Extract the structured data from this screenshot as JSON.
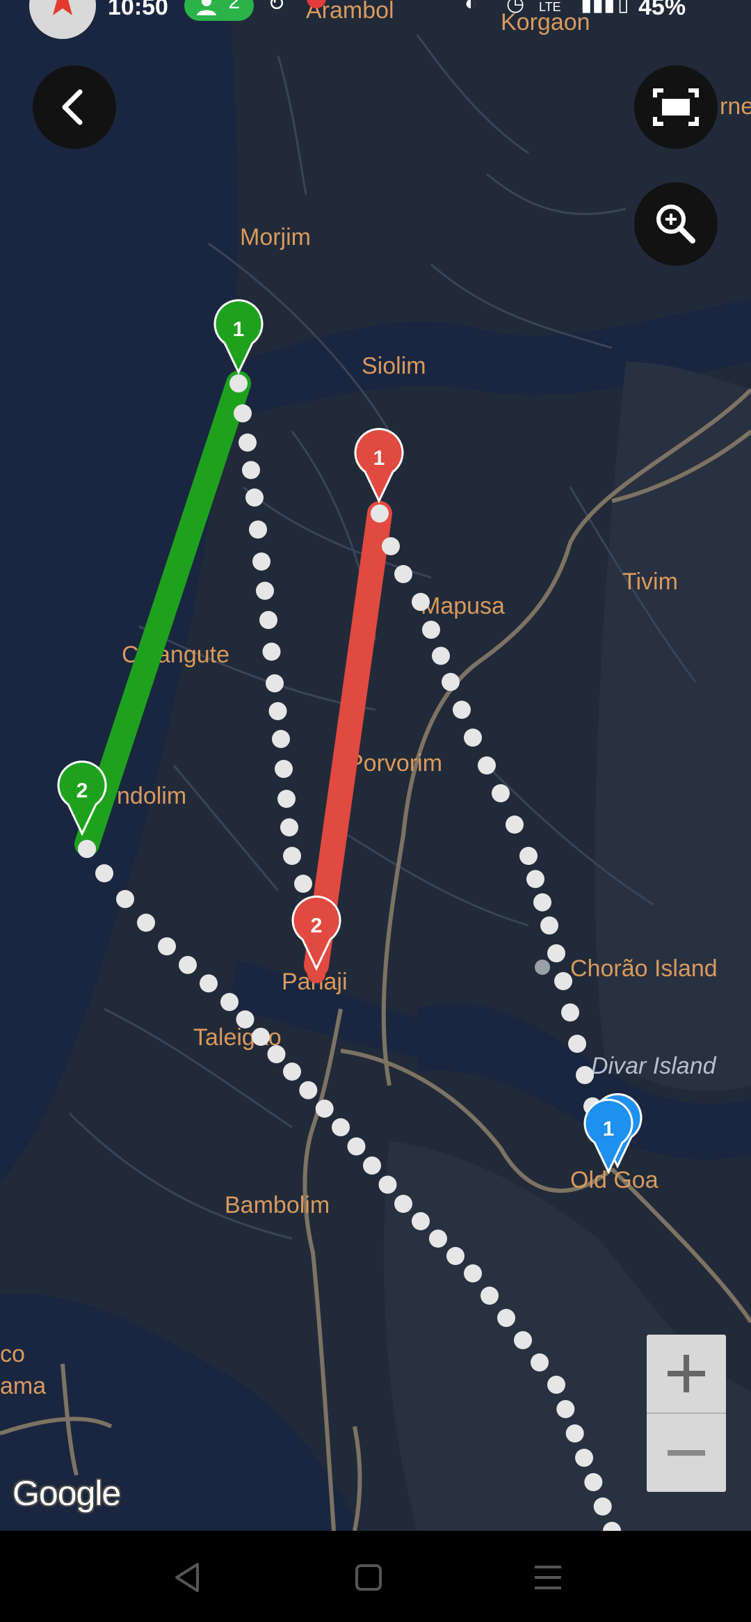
{
  "status_bar": {
    "time": "10:50",
    "notification_count": "2",
    "battery": "45%",
    "icons": [
      "sync-icon",
      "app-notification-icon",
      "vpn-icon",
      "alarm-icon",
      "lte-icon",
      "signal-icon",
      "battery-icon"
    ]
  },
  "map": {
    "provider_logo": "Google",
    "places": {
      "arambol": "Arambol",
      "korgaon": "Korgaon",
      "morjim": "Morjim",
      "siolim": "Siolim",
      "tivim": "Tivim",
      "mapusa": "Mapusa",
      "calangute": "Calangute",
      "candolim": "ndolim",
      "porvorim": "Porvorim",
      "panaji": "Panaji",
      "taleigao": "Taleigao",
      "chorao_island": "Chorão Island",
      "divar_island": "Divar Island",
      "old_goa": "Old Goa",
      "bambolim": "Bambolim",
      "edge_co": "co",
      "edge_ama": "ama",
      "edge_rne": "rne"
    },
    "colors": {
      "background": "#212a38",
      "water": "#1a2640",
      "road": "#7d7363",
      "green_route": "#1ea21e",
      "red_route": "#e04a40",
      "blue_marker": "#1f8ff0",
      "dotted_route": "#e6e6e6"
    },
    "markers": {
      "green_start": "1",
      "green_end": "2",
      "red_start": "1",
      "red_end": "2",
      "blue_1": "1"
    }
  },
  "controls": {
    "back": "chevron-left-icon",
    "fullscreen": "fullscreen-icon",
    "zoom_search": "zoom-in-search-icon",
    "zoom_in": "+",
    "zoom_out": "−"
  },
  "navbar": {
    "icons": [
      "back-triangle-icon",
      "home-square-icon",
      "menu-lines-icon"
    ]
  }
}
